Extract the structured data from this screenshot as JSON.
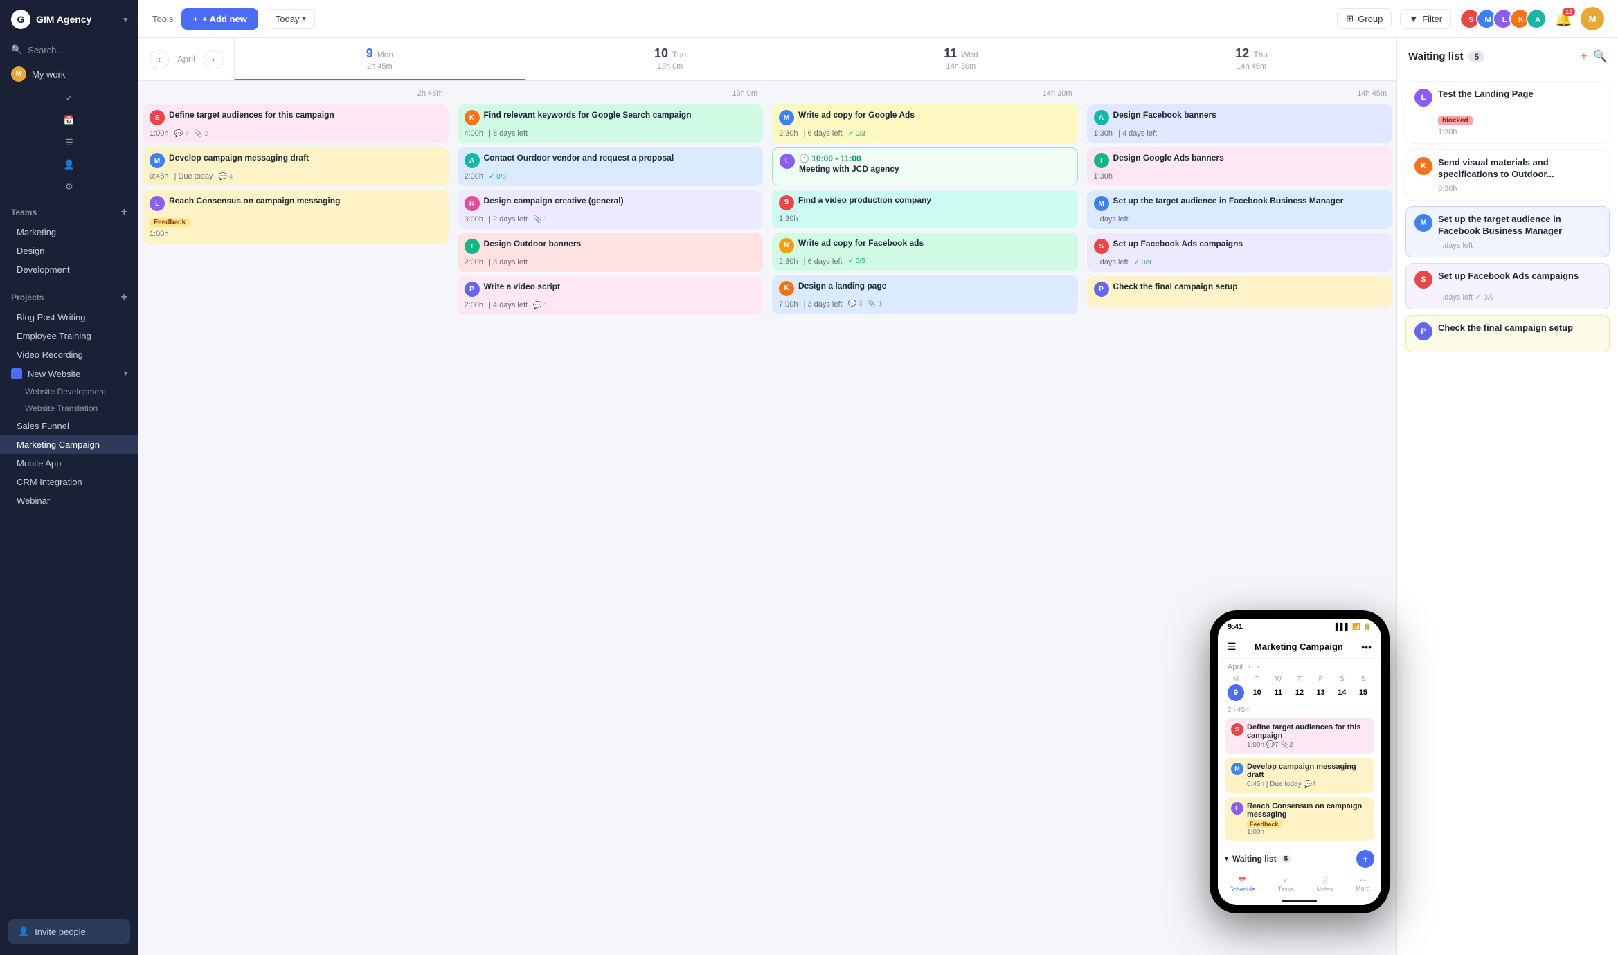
{
  "app": {
    "name": "GIM Agency",
    "logo_letter": "G"
  },
  "sidebar": {
    "search_placeholder": "Search...",
    "my_work": "My work",
    "teams_label": "Teams",
    "teams": [
      {
        "id": "marketing",
        "label": "Marketing"
      },
      {
        "id": "design",
        "label": "Design"
      },
      {
        "id": "development",
        "label": "Development"
      }
    ],
    "projects_label": "Projects",
    "projects": [
      {
        "id": "blog-post",
        "label": "Blog Post Writing"
      },
      {
        "id": "employee-training",
        "label": "Employee Training"
      },
      {
        "id": "video-recording",
        "label": "Video Recording"
      },
      {
        "id": "new-website",
        "label": "New Website",
        "has_folder": true,
        "expanded": true
      },
      {
        "id": "website-dev",
        "label": "Website Development",
        "sub": true
      },
      {
        "id": "website-trans",
        "label": "Website Translation",
        "sub": true
      },
      {
        "id": "sales-funnel",
        "label": "Sales Funnel"
      },
      {
        "id": "marketing-campaign",
        "label": "Marketing Campaign",
        "active": true
      },
      {
        "id": "mobile-app",
        "label": "Mobile App"
      },
      {
        "id": "crm-integration",
        "label": "CRM Integration"
      },
      {
        "id": "webinar",
        "label": "Webinar"
      }
    ],
    "invite_label": "Invite people"
  },
  "toolbar": {
    "add_new_label": "+ Add new",
    "today_label": "Today",
    "group_label": "Group",
    "filter_label": "Filter",
    "notif_count": "12"
  },
  "calendar": {
    "month": "April",
    "columns": [
      {
        "num": "9",
        "day": "Mon",
        "hours": "2h 45m",
        "active": true
      },
      {
        "num": "10",
        "day": "Tue",
        "hours": "13h 0m"
      },
      {
        "num": "11",
        "day": "Wed",
        "hours": "14h 30m"
      },
      {
        "num": "12",
        "day": "Thu",
        "hours": "14h 45m"
      }
    ],
    "col0_tasks": [
      {
        "name": "Define target audiences for this campaign",
        "time": "1:00h",
        "comments": "7",
        "attachments": "2",
        "color": "pink",
        "avatar_color": "av-red",
        "avatar_letter": "S"
      },
      {
        "name": "Develop campaign messaging draft",
        "time": "0:45h",
        "due": "Due today",
        "comments": "4",
        "color": "orange",
        "avatar_color": "av-blue",
        "avatar_letter": "M"
      },
      {
        "name": "Reach Consensus on campaign messaging",
        "time": "1:00h",
        "tag": "Feedback",
        "color": "orange",
        "tag_type": "feedback",
        "avatar_color": "av-purple",
        "avatar_letter": "L"
      }
    ],
    "col1_tasks": [
      {
        "name": "Find relevant keywords for Google Search campaign",
        "time": "4:00h",
        "days_left": "8 days left",
        "color": "green",
        "avatar_color": "av-orange",
        "avatar_letter": "K"
      },
      {
        "name": "Contact Ourdoor vendor and request a proposal",
        "time": "2:00h",
        "checks": "0/8",
        "color": "blue",
        "avatar_color": "av-teal",
        "avatar_letter": "A"
      },
      {
        "name": "Design campaign creative (general)",
        "time": "3:00h",
        "days_left": "2 days left",
        "attachments": "1",
        "color": "purple",
        "avatar_color": "av-pink",
        "avatar_letter": "R"
      },
      {
        "name": "Design Outdoor banners",
        "time": "2:00h",
        "days_left": "3 days left",
        "color": "red",
        "avatar_color": "av-green",
        "avatar_letter": "T"
      },
      {
        "name": "Write a video script",
        "time": "2:00h",
        "days_left": "4 days left",
        "comments": "1",
        "color": "pink",
        "avatar_color": "av-indigo",
        "avatar_letter": "P"
      }
    ],
    "col2_tasks": [
      {
        "name": "Write ad copy for Google Ads",
        "time": "2:30h",
        "days_left": "6 days left",
        "checks": "0/3",
        "color": "yellow",
        "avatar_color": "av-blue",
        "avatar_letter": "M"
      },
      {
        "meeting_time": "10:00 - 11:00",
        "name": "Meeting with JCD agency",
        "color": "meeting",
        "avatar_color": "av-purple",
        "avatar_letter": "L",
        "is_meeting": true
      },
      {
        "name": "Find a video production company",
        "time": "1:30h",
        "color": "teal",
        "avatar_color": "av-red",
        "avatar_letter": "S"
      },
      {
        "name": "Write ad copy for Facebook ads",
        "time": "2:30h",
        "days_left": "6 days left",
        "checks": "0/5",
        "color": "green",
        "avatar_color": "av-yellow",
        "avatar_letter": "N"
      },
      {
        "name": "Design a landing page",
        "time": "7:00h",
        "days_left": "3 days left",
        "comments": "3",
        "attachments": "1",
        "color": "blue",
        "avatar_color": "av-orange",
        "avatar_letter": "K"
      }
    ],
    "col3_tasks": [
      {
        "name": "Design Facebook banners",
        "time": "1:30h",
        "days_left": "4 days left",
        "color": "indigo",
        "avatar_color": "av-teal",
        "avatar_letter": "A"
      },
      {
        "name": "Design Google Ads banners",
        "time": "1:30h",
        "color": "pink",
        "avatar_color": "av-green",
        "avatar_letter": "T"
      },
      {
        "name": "Set up the target audience in Facebook Business Manager",
        "days_left": "days left",
        "color": "blue",
        "avatar_color": "av-blue",
        "avatar_letter": "M",
        "truncated": true
      },
      {
        "name": "Set up Facebook Ads campaigns",
        "days_left": "days left",
        "checks": "0/9",
        "color": "purple",
        "avatar_color": "av-red",
        "avatar_letter": "S",
        "truncated": true
      },
      {
        "name": "Check the final campaign setup",
        "color": "orange",
        "avatar_color": "av-indigo",
        "avatar_letter": "P",
        "truncated": true
      }
    ]
  },
  "waiting_list": {
    "title": "Waiting list",
    "count": "5",
    "cards": [
      {
        "title": "Test the Landing Page",
        "tag": "blocked",
        "tag_label": "blocked",
        "time": "1:30h",
        "avatar_color": "av-purple",
        "avatar_letter": "L"
      },
      {
        "title": "Send visual materials and specifications to Outdoor...",
        "time": "0:30h",
        "avatar_color": "av-orange",
        "avatar_letter": "K"
      },
      {
        "title": "Set up the target audience in Facebook Business Manager",
        "days_left": "days left",
        "avatar_color": "av-blue",
        "avatar_letter": "M"
      },
      {
        "title": "Set up Facebook Ads campaigns",
        "checks": "0/9",
        "days_left": "days left",
        "avatar_color": "av-red",
        "avatar_letter": "S"
      },
      {
        "title": "Check the final campaign setup",
        "avatar_color": "av-indigo",
        "avatar_letter": "P"
      }
    ]
  },
  "phone": {
    "time": "9:41",
    "title": "Marketing Campaign",
    "month": "April",
    "cal_days": [
      {
        "letter": "M",
        "num": "9",
        "active": true
      },
      {
        "letter": "T",
        "num": "10"
      },
      {
        "letter": "W",
        "num": "11"
      },
      {
        "letter": "T",
        "num": "12"
      },
      {
        "letter": "F",
        "num": "13"
      },
      {
        "letter": "S",
        "num": "14"
      },
      {
        "letter": "S",
        "num": "15"
      }
    ],
    "hours_label": "2h 45m",
    "tasks": [
      {
        "name": "Define target audiences for this campaign",
        "meta": "1:00h  ☁7  📎2",
        "color": "pink"
      },
      {
        "name": "Develop campaign messaging draft",
        "meta": "0:45h | Due today  ☁4",
        "color": "orange"
      },
      {
        "name": "Reach Consensus on campaign messaging",
        "meta": "Feedback\n1:00h",
        "color": "orange"
      }
    ],
    "waiting_label": "Waiting list",
    "waiting_count": "5",
    "nav_items": [
      {
        "label": "Schedule",
        "active": true,
        "icon": "📅"
      },
      {
        "label": "Tasks",
        "active": false,
        "icon": "✓"
      },
      {
        "label": "Notes",
        "active": false,
        "icon": "📄"
      },
      {
        "label": "More",
        "active": false,
        "icon": "•••"
      }
    ]
  }
}
